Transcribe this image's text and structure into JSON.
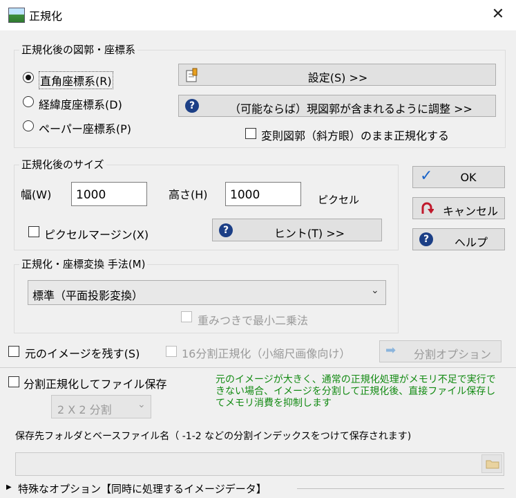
{
  "window": {
    "title": "正規化",
    "close_glyph": "✕"
  },
  "group_coords": {
    "legend": "正規化後の図郭・座標系",
    "radios": [
      {
        "label": "直角座標系(R)",
        "selected": true
      },
      {
        "label": "経緯度座標系(D)",
        "selected": false
      },
      {
        "label": "ペーパー座標系(P)",
        "selected": false
      }
    ],
    "settings_button": "設定(S) >>",
    "adjust_button": "（可能ならば）現図郭が含まれるように調整 >>",
    "keep_irregular_check": "変則図郭（斜方眼）のまま正規化する"
  },
  "group_size": {
    "legend": "正規化後のサイズ",
    "width_label": "幅(W)",
    "width_value": "1000",
    "height_label": "高さ(H)",
    "height_value": "1000",
    "unit_label": "ピクセル",
    "margin_check": "ピクセルマージン(X)",
    "hint_button": "ヒント(T) >>"
  },
  "group_method": {
    "legend": "正規化・座標変換 手法(M)",
    "selected_method": "標準（平面投影変換）",
    "weighted_check": "重みつきで最小二乗法"
  },
  "side_buttons": {
    "ok": "OK",
    "cancel": "キャンセル",
    "help": "ヘルプ"
  },
  "bottom": {
    "keep_original_check": "元のイメージを残す(S)",
    "split16_check": "16分割正規化（小縮尺画像向け）",
    "split_options_button": "分割オプション",
    "split_save_check": "分割正規化してファイル保存",
    "split_select": "2 X 2 分割",
    "note": "元のイメージが大きく、通常の正規化処理がメモリ不足で実行できない場合、イメージを分割して正規化後、直接ファイル保存してメモリ消費を抑制します",
    "save_path_label": "保存先フォルダとベースファイル名（ -1-2 などの分割インデックスをつけて保存されます)",
    "save_path_value": "",
    "special_options": "特殊なオプション【同時に処理するイメージデータ】"
  },
  "colors": {
    "note_green": "#128a12",
    "icon_blue": "#1c3f86",
    "cancel_red": "#c0182b",
    "ok_blue": "#1a64c8"
  }
}
